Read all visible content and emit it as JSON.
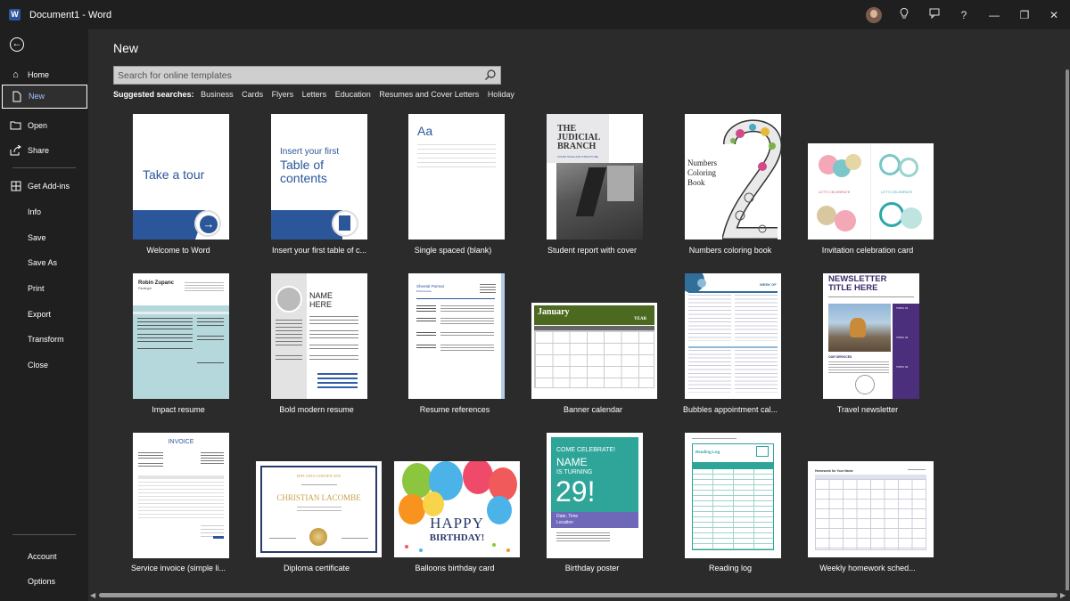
{
  "window": {
    "title": "Document1  -  Word",
    "app_icon": "W"
  },
  "titlebar": {
    "lightbulb": "lightbulb-icon",
    "feedback": "feedback-icon",
    "help": "?",
    "minimize": "—",
    "restore": "❐",
    "close": "✕"
  },
  "sidebar": {
    "items": [
      {
        "label": "Home"
      },
      {
        "label": "New"
      },
      {
        "label": "Open"
      },
      {
        "label": "Share"
      },
      {
        "label": "Get Add-ins"
      },
      {
        "label": "Info"
      },
      {
        "label": "Save"
      },
      {
        "label": "Save As"
      },
      {
        "label": "Print"
      },
      {
        "label": "Export"
      },
      {
        "label": "Transform"
      },
      {
        "label": "Close"
      }
    ],
    "bottom": [
      {
        "label": "Account"
      },
      {
        "label": "Options"
      }
    ]
  },
  "main": {
    "title": "New",
    "search_placeholder": "Search for online templates",
    "suggested_label": "Suggested searches:",
    "suggested": [
      "Business",
      "Cards",
      "Flyers",
      "Letters",
      "Education",
      "Resumes and Cover Letters",
      "Holiday"
    ]
  },
  "templates": [
    {
      "caption": "Welcome to Word",
      "text": "Take a tour"
    },
    {
      "caption": "Insert your first table of c...",
      "text": [
        "Insert your first",
        "Table of",
        "contents"
      ]
    },
    {
      "caption": "Single spaced (blank)",
      "text": "Aa"
    },
    {
      "caption": "Student report with cover",
      "text": [
        "THE",
        "JUDICIAL",
        "BRANCH"
      ],
      "sub": "COURT ROLE AND STRUCTURE"
    },
    {
      "caption": "Numbers coloring book",
      "text": [
        "Numbers",
        "Coloring",
        "Book"
      ]
    },
    {
      "caption": "Invitation celebration card",
      "text": [
        "LET'S CELEBRATE",
        "LET'S CELEBRATE"
      ]
    },
    {
      "caption": "Impact resume",
      "text": [
        "Robin Zupanc",
        "Paralegal"
      ]
    },
    {
      "caption": "Bold modern resume",
      "text": [
        "NAME",
        "HERE"
      ]
    },
    {
      "caption": "Resume references",
      "text": [
        "Sheetal Parmar",
        "Photocourse"
      ]
    },
    {
      "caption": "Banner calendar",
      "text": [
        "January",
        "YEAR"
      ]
    },
    {
      "caption": "Bubbles appointment cal...",
      "text": [
        "WEEK OF"
      ]
    },
    {
      "caption": "Travel newsletter",
      "text": [
        "NEWSLETTER",
        "TITLE HERE",
        "OUR SERVICES",
        "TOPIC 01",
        "TOPIC 02",
        "TOPIC 03"
      ]
    },
    {
      "caption": "Service invoice (simple li...",
      "text": [
        "INVOICE"
      ]
    },
    {
      "caption": "Diploma certificate",
      "text": [
        "DIPLOMA CERTIFICATE",
        "CHRISTIAN LACOMBE"
      ]
    },
    {
      "caption": "Balloons birthday card",
      "text": [
        "HAPPY",
        "BIRTHDAY!"
      ]
    },
    {
      "caption": "Birthday poster",
      "text": [
        "COME CELEBRATE!",
        "NAME",
        "IS TURNING",
        "29!",
        "Date, Time",
        "Location"
      ]
    },
    {
      "caption": "Reading log",
      "text": [
        "Reading Log"
      ]
    },
    {
      "caption": "Weekly homework sched...",
      "text": [
        "Homework for Your Name"
      ]
    }
  ],
  "colors": {
    "accent": "#2b579a",
    "background": "#2b2b2b",
    "sidebar": "#1f1f1f",
    "selected_text": "#9cc3ff"
  }
}
